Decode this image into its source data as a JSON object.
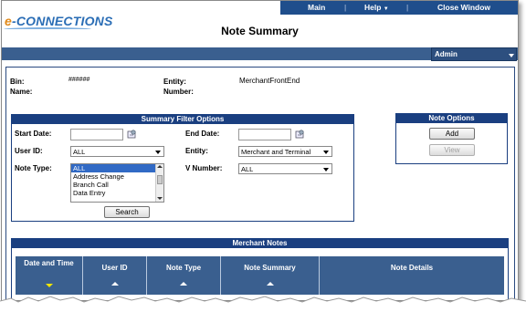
{
  "nav": {
    "main": "Main",
    "sep": "|",
    "help": "Help",
    "close": "Close Window"
  },
  "logo": {
    "prefix": "e",
    "rest": "-CONNECTIONS"
  },
  "page_title": "Note Summary",
  "role": "Admin",
  "info": {
    "bin_label": "Bin:",
    "bin_value": "######",
    "name_label": "Name:",
    "entity_label": "Entity:",
    "entity_value": "MerchantFrontEnd",
    "number_label": "Number:"
  },
  "filter": {
    "title": "Summary Filter Options",
    "start_date_label": "Start Date:",
    "end_date_label": "End Date:",
    "user_id_label": "User ID:",
    "user_id_value": "ALL",
    "entity_label": "Entity:",
    "entity_value": "Merchant and Terminal",
    "note_type_label": "Note Type:",
    "note_types": [
      "ALL",
      "Address Change",
      "Branch Call",
      "Data Entry"
    ],
    "vnumber_label": "V Number:",
    "vnumber_value": "ALL",
    "search_label": "Search"
  },
  "note_options": {
    "title": "Note Options",
    "add": "Add",
    "view": "View"
  },
  "notes": {
    "title": "Merchant Notes",
    "columns": [
      "Date and Time",
      "User ID",
      "Note Type",
      "Note Summary",
      "Note Details"
    ]
  },
  "colors": {
    "nav_bg": "#1f4e8c",
    "panel_title": "#1a3f80",
    "grid_head": "#3a5f8f"
  }
}
